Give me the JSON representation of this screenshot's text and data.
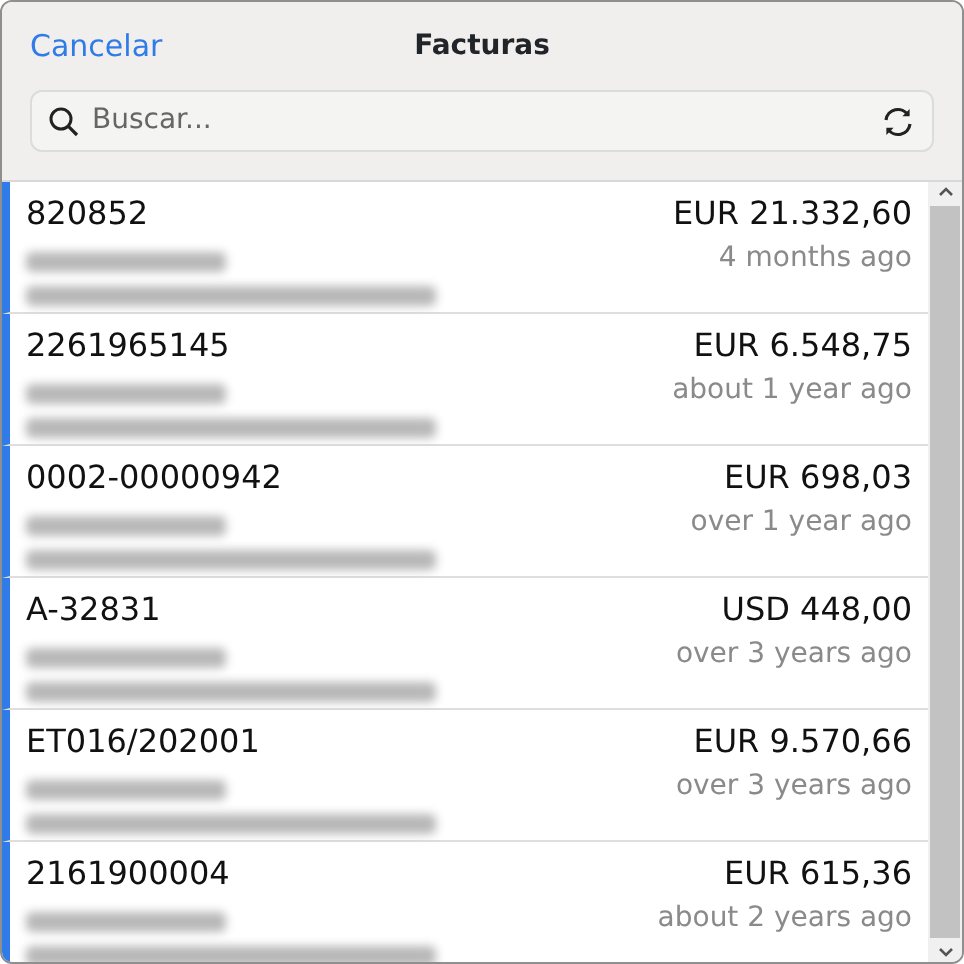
{
  "header": {
    "cancel": "Cancelar",
    "title": "Facturas"
  },
  "search": {
    "placeholder": "Buscar..."
  },
  "invoices": [
    {
      "number": "820852",
      "amount": "EUR 21.332,60",
      "age": "4 months ago",
      "details": [
        {
          "kind": "blurred"
        },
        {
          "kind": "blurred"
        }
      ]
    },
    {
      "number": "2261965145",
      "amount": "EUR 6.548,75",
      "age": "about 1 year ago",
      "details": [
        {
          "kind": "blurred"
        },
        {
          "kind": "blurred"
        }
      ]
    },
    {
      "number": "0002-00000942",
      "amount": "EUR 698,03",
      "age": "over 1 year ago",
      "details": [
        {
          "kind": "blurred"
        },
        {
          "kind": "blurred"
        }
      ]
    },
    {
      "number": "A-32831",
      "amount": "USD 448,00",
      "age": "over 3 years ago",
      "details": [
        {
          "kind": "blurred"
        },
        {
          "kind": "blurred"
        }
      ]
    },
    {
      "number": "ET016/202001",
      "amount": "EUR 9.570,66",
      "age": "over 3 years ago",
      "details": [
        {
          "kind": "blurred"
        },
        {
          "kind": "blurred"
        }
      ]
    },
    {
      "number": "2161900004",
      "amount": "EUR 615,36",
      "age": "about 2 years ago",
      "details": [
        {
          "kind": "blurred"
        },
        {
          "kind": "blurred"
        }
      ]
    }
  ]
}
